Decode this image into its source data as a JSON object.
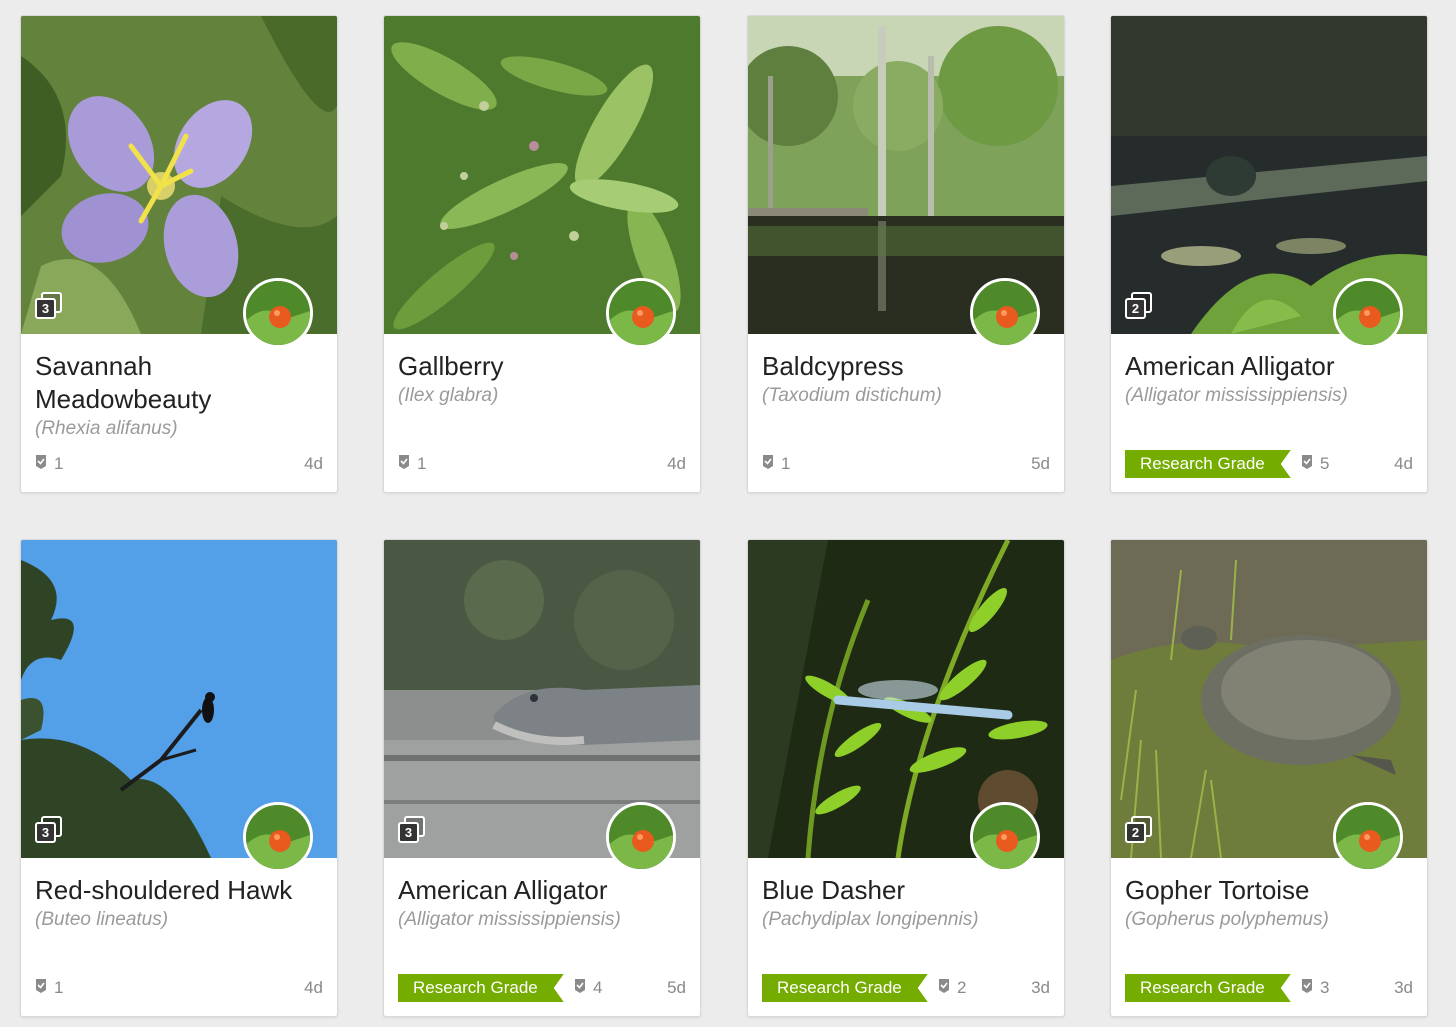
{
  "observations": [
    {
      "common_name": "Savannah Meadowbeauty",
      "scientific_name": "(Rhexia alifanus)",
      "photo_count": "3",
      "quality": "",
      "identifications": "1",
      "age": "4d",
      "photo_subject": "flower",
      "palette": [
        "#5a7a36",
        "#a99ad8",
        "#f2e24a"
      ]
    },
    {
      "common_name": "Gallberry",
      "scientific_name": "(Ilex glabra)",
      "photo_count": "",
      "quality": "",
      "identifications": "1",
      "age": "4d",
      "photo_subject": "leaves",
      "palette": [
        "#4e7a2e",
        "#7fae4a",
        "#c2cf9a"
      ]
    },
    {
      "common_name": "Baldcypress",
      "scientific_name": "(Taxodium distichum)",
      "photo_count": "",
      "quality": "",
      "identifications": "1",
      "age": "5d",
      "photo_subject": "swamp",
      "palette": [
        "#7ea25a",
        "#2a2e20",
        "#dfe6d6"
      ]
    },
    {
      "common_name": "American Alligator",
      "scientific_name": "(Alligator mississippiensis)",
      "photo_count": "2",
      "quality": "Research Grade",
      "identifications": "5",
      "age": "4d",
      "photo_subject": "dark water",
      "palette": [
        "#262c2c",
        "#5d6a5a",
        "#6fa23a"
      ]
    },
    {
      "common_name": "Red-shouldered Hawk",
      "scientific_name": "(Buteo lineatus)",
      "photo_count": "3",
      "quality": "",
      "identifications": "1",
      "age": "4d",
      "photo_subject": "sky",
      "palette": [
        "#4d9be6",
        "#2f4424",
        "#111111"
      ]
    },
    {
      "common_name": "American Alligator",
      "scientific_name": "(Alligator mississippiensis)",
      "photo_count": "3",
      "quality": "Research Grade",
      "identifications": "4",
      "age": "5d",
      "photo_subject": "alligator on dock",
      "palette": [
        "#3f4b3a",
        "#8c8f8e",
        "#bfc0bd"
      ]
    },
    {
      "common_name": "Blue Dasher",
      "scientific_name": "(Pachydiplax longipennis)",
      "photo_count": "",
      "quality": "Research Grade",
      "identifications": "2",
      "age": "3d",
      "photo_subject": "fern",
      "palette": [
        "#1e2a14",
        "#8fcf2a",
        "#a9cbe6"
      ]
    },
    {
      "common_name": "Gopher Tortoise",
      "scientific_name": "(Gopherus polyphemus)",
      "photo_count": "2",
      "quality": "Research Grade",
      "identifications": "3",
      "age": "3d",
      "photo_subject": "tortoise",
      "palette": [
        "#5e6a36",
        "#6e6f63",
        "#a6a48a"
      ]
    }
  ],
  "icons": {
    "identifications": "identification-tag-icon",
    "photos": "photo-stack-icon",
    "avatar": "user-avatar"
  },
  "colors": {
    "research_grade": "#74ac00",
    "muted_text": "#9a9a9a",
    "background": "#ececec"
  }
}
